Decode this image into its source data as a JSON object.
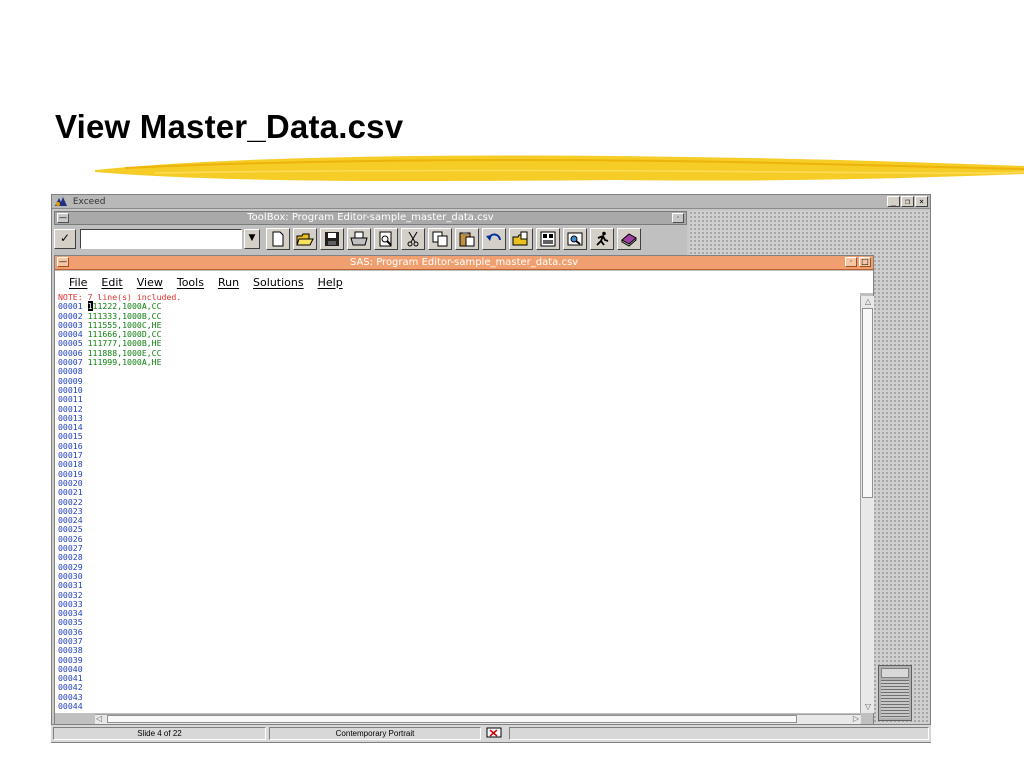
{
  "slide": {
    "title": "View Master_Data.csv"
  },
  "exceed": {
    "title": "Exceed",
    "buttons": {
      "minimize": "_",
      "restore": "❐",
      "close": "×"
    }
  },
  "toolbox": {
    "title": "ToolBox: Program Editor-sample_master_data.csv",
    "command_check": "✓",
    "command_value": "",
    "tools": [
      "new-icon",
      "open-icon",
      "save-icon",
      "print-icon",
      "print-preview-icon",
      "cut-icon",
      "copy-icon",
      "paste-icon",
      "undo-icon",
      "open-file-icon",
      "submit-icon",
      "find-icon",
      "run-icon",
      "help-book-icon"
    ]
  },
  "editor": {
    "title": "SAS: Program Editor-sample_master_data.csv",
    "menu": [
      "File",
      "Edit",
      "View",
      "Tools",
      "Run",
      "Solutions",
      "Help"
    ],
    "note": "NOTE: 7 line(s) included.",
    "lines": [
      {
        "n": "00001",
        "t": "111222,1000A,CC"
      },
      {
        "n": "00002",
        "t": "111333,1000B,CC"
      },
      {
        "n": "00003",
        "t": "111555,1000C,HE"
      },
      {
        "n": "00004",
        "t": "111666,1000D,CC"
      },
      {
        "n": "00005",
        "t": "111777,1000B,HE"
      },
      {
        "n": "00006",
        "t": "111888,1000E,CC"
      },
      {
        "n": "00007",
        "t": "111999,1000A,HE"
      },
      {
        "n": "00008",
        "t": ""
      },
      {
        "n": "00009",
        "t": ""
      },
      {
        "n": "00010",
        "t": ""
      },
      {
        "n": "00011",
        "t": ""
      },
      {
        "n": "00012",
        "t": ""
      },
      {
        "n": "00013",
        "t": ""
      },
      {
        "n": "00014",
        "t": ""
      },
      {
        "n": "00015",
        "t": ""
      },
      {
        "n": "00016",
        "t": ""
      },
      {
        "n": "00017",
        "t": ""
      },
      {
        "n": "00018",
        "t": ""
      },
      {
        "n": "00019",
        "t": ""
      },
      {
        "n": "00020",
        "t": ""
      },
      {
        "n": "00021",
        "t": ""
      },
      {
        "n": "00022",
        "t": ""
      },
      {
        "n": "00023",
        "t": ""
      },
      {
        "n": "00024",
        "t": ""
      },
      {
        "n": "00025",
        "t": ""
      },
      {
        "n": "00026",
        "t": ""
      },
      {
        "n": "00027",
        "t": ""
      },
      {
        "n": "00028",
        "t": ""
      },
      {
        "n": "00029",
        "t": ""
      },
      {
        "n": "00030",
        "t": ""
      },
      {
        "n": "00031",
        "t": ""
      },
      {
        "n": "00032",
        "t": ""
      },
      {
        "n": "00033",
        "t": ""
      },
      {
        "n": "00034",
        "t": ""
      },
      {
        "n": "00035",
        "t": ""
      },
      {
        "n": "00036",
        "t": ""
      },
      {
        "n": "00037",
        "t": ""
      },
      {
        "n": "00038",
        "t": ""
      },
      {
        "n": "00039",
        "t": ""
      },
      {
        "n": "00040",
        "t": ""
      },
      {
        "n": "00041",
        "t": ""
      },
      {
        "n": "00042",
        "t": ""
      },
      {
        "n": "00043",
        "t": ""
      },
      {
        "n": "00044",
        "t": ""
      }
    ]
  },
  "statusbar": {
    "slide_info": "Slide 4 of 22",
    "design": "Contemporary Portrait"
  },
  "colors": {
    "editor_title": "#f0a070",
    "note": "#e03030",
    "line_number": "#2040c0",
    "content": "#108010",
    "brush": "#f5c400"
  }
}
